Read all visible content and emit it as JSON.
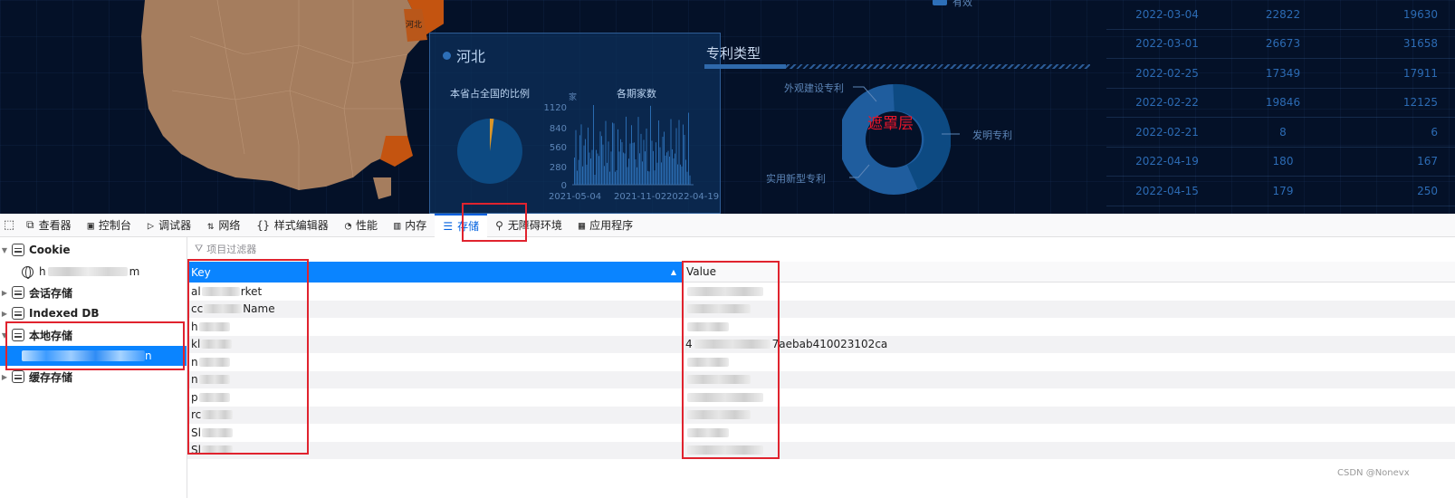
{
  "dashboard": {
    "map_label": "河北",
    "panel": {
      "title": "河北",
      "ratio_title": "本省占全国的比例",
      "count_title": "各期家数",
      "y_axis_unit": "家",
      "y_ticks": [
        "1120",
        "840",
        "560",
        "280",
        "0"
      ],
      "x_ticks": [
        "2021-05-04",
        "2021-11-02",
        "2022-04-19"
      ]
    },
    "patent": {
      "title": "专利类型",
      "labels": {
        "design": "外观建设专利",
        "invention": "发明专利",
        "utility": "实用新型专利"
      },
      "mask_label": "遮罩层",
      "legend_fragment": "有效"
    },
    "date_rows": [
      [
        "2022-03-04",
        "22822",
        "19630"
      ],
      [
        "2022-03-01",
        "26673",
        "31658"
      ],
      [
        "2022-02-25",
        "17349",
        "17911"
      ],
      [
        "2022-02-22",
        "19846",
        "12125"
      ],
      [
        "2022-02-21",
        "8",
        "6"
      ],
      [
        "2022-04-19",
        "180",
        "167"
      ],
      [
        "2022-04-15",
        "179",
        "250"
      ]
    ],
    "colors": {
      "bg": "#041128",
      "map_fill": "#a57d5e",
      "map_highlight": "#c45410",
      "accent": "#2d6fb8",
      "mask_text": "#e5162b"
    }
  },
  "toolbar": {
    "tabs": [
      {
        "id": "inspector",
        "icon": "⧉",
        "label": "查看器"
      },
      {
        "id": "console",
        "icon": "▣",
        "label": "控制台"
      },
      {
        "id": "debugger",
        "icon": "▷",
        "label": "调试器"
      },
      {
        "id": "network",
        "icon": "⇅",
        "label": "网络"
      },
      {
        "id": "style",
        "icon": "{}",
        "label": "样式编辑器"
      },
      {
        "id": "performance",
        "icon": "◔",
        "label": "性能"
      },
      {
        "id": "memory",
        "icon": "▥",
        "label": "内存"
      },
      {
        "id": "storage",
        "icon": "☰",
        "label": "存储"
      },
      {
        "id": "accessibility",
        "icon": "⚲",
        "label": "无障碍环境"
      },
      {
        "id": "application",
        "icon": "▦",
        "label": "应用程序"
      }
    ]
  },
  "tree": {
    "cookie": "Cookie",
    "cookie_host_prefix": "h",
    "cookie_host_suffix": "m",
    "session": "会话存储",
    "indexeddb": "Indexed DB",
    "local": "本地存储",
    "local_host_suffix": "n",
    "cache": "缓存存储"
  },
  "table": {
    "filter_placeholder": "项目过滤器",
    "key_header": "Key",
    "value_header": "Value",
    "rows": [
      {
        "k1": "al",
        "k2": "rket",
        "v1": "",
        "v2": ""
      },
      {
        "k1": "cc",
        "k2": "Name",
        "v1": "",
        "v2": ""
      },
      {
        "k1": "h",
        "k2": "",
        "v1": "",
        "v2": ""
      },
      {
        "k1": "kl",
        "k2": "",
        "v1": "4",
        "v2": "7aebab410023102ca"
      },
      {
        "k1": "n",
        "k2": "",
        "v1": "",
        "v2": ""
      },
      {
        "k1": "n",
        "k2": "",
        "v1": "",
        "v2": ""
      },
      {
        "k1": "p",
        "k2": "",
        "v1": "",
        "v2": ""
      },
      {
        "k1": "rc",
        "k2": "",
        "v1": "",
        "v2": ""
      },
      {
        "k1": "Sl",
        "k2": "",
        "v1": "",
        "v2": ""
      },
      {
        "k1": "Sl",
        "k2": "",
        "v1": "",
        "v2": ""
      }
    ]
  },
  "watermark": "CSDN @Nonevx"
}
